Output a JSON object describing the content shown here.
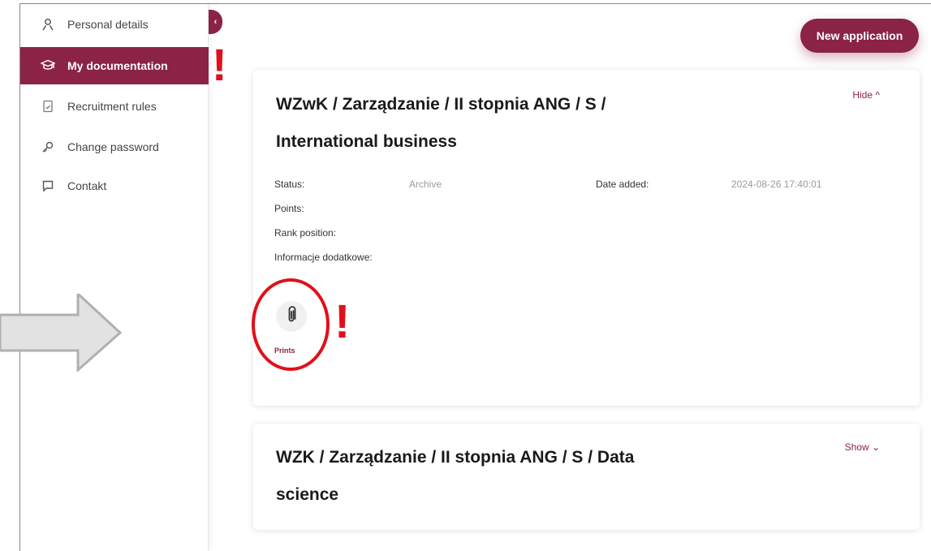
{
  "sidebar": {
    "items": [
      {
        "label": "Personal details",
        "icon": "person-icon"
      },
      {
        "label": "My documentation",
        "icon": "graduation-cap-icon",
        "active": true
      },
      {
        "label": "Recruitment rules",
        "icon": "document-icon"
      },
      {
        "label": "Change password",
        "icon": "key-icon"
      },
      {
        "label": "Contakt",
        "icon": "chat-icon"
      }
    ],
    "collapse_glyph": "‹"
  },
  "header": {
    "new_application_label": "New application"
  },
  "cards": [
    {
      "title": "WZwK / Zarządzanie / II stopnia ANG / S / International business",
      "toggle_label": "Hide ^",
      "fields": {
        "status_label": "Status:",
        "status_value": "Archive",
        "date_added_label": "Date added:",
        "date_added_value": "2024-08-26 17:40:01",
        "points_label": "Points:",
        "rank_label": "Rank position:",
        "info_label": "Informacje dodatkowe:"
      },
      "attachment": {
        "label": "Prints",
        "icon": "paperclip-icon"
      }
    },
    {
      "title": "WZK / Zarządzanie / II stopnia ANG / S / Data science",
      "toggle_label": "Show ⌄"
    }
  ],
  "annotations": {
    "exclamation": "!"
  },
  "colors": {
    "accent": "#8b2346",
    "annotation": "#e0101a"
  }
}
